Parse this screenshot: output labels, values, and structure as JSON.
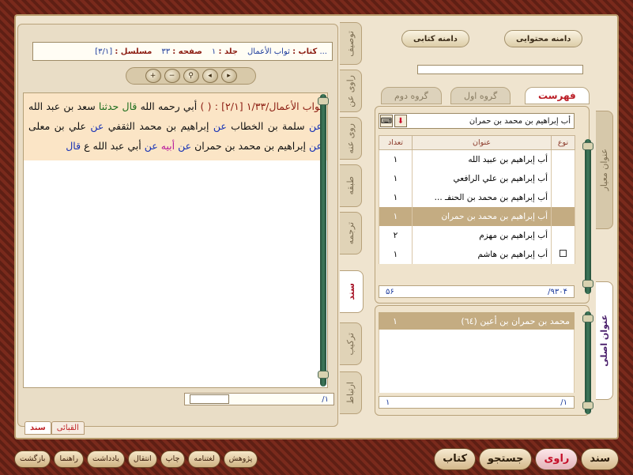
{
  "meta": {
    "book_label": "کتاب :",
    "book_value": "ثواب الأعمال",
    "ellipsis": "...",
    "volume_label": "جلد :",
    "volume_value": "۱",
    "page_label": "صفحه :",
    "page_value": "۳۳",
    "serial_label": "مسلسل :",
    "serial_value": "[۳/۱]"
  },
  "toolbar_icons": [
    "zoom-in",
    "zoom-out",
    "search",
    "prev",
    "next"
  ],
  "hadith": {
    "ref": "ثواب الأعمال/۱/۳۳ [۲/۱] : ( )",
    "p1": "أبي رحمه الله",
    "p2": "قال حدثنا",
    "p3": "سعد بن عبد الله",
    "p4": "عن",
    "p5": "سلمة بن الخطاب",
    "p6": "عن",
    "p7": "إبراهيم بن محمد الثقفي",
    "p8": "عن",
    "p9": "علي بن معلى",
    "p10": "عن",
    "p11": "إبراهيم بن محمد بن حمران",
    "p12": "عن",
    "p13": "أبيه",
    "p14": "عن",
    "p15": "أبي عبد الله ع",
    "p16": "قال"
  },
  "left_footer": {
    "page": "/۱"
  },
  "left_tags": {
    "active": "سند",
    "other": "القبائی"
  },
  "vertical_tabs": [
    "توصیف",
    "راوی عن",
    "روی عنه",
    "طبقه",
    "ترجمه",
    "سند",
    "ترکیب",
    "ارتباط"
  ],
  "vertical_tab_active": "سند",
  "top_pills": {
    "doc_scope": "دامنه کتابی",
    "content_scope": "دامنه محتوایی"
  },
  "group_tabs": {
    "index": "فهرست",
    "group1": "گروه اول",
    "group2": "گروه دوم"
  },
  "list": {
    "selected_value": "أب إبراهيم بن محمد بن حمران",
    "headers": {
      "count": "تعداد",
      "title": "عنوان",
      "type": "نوع"
    },
    "rows": [
      {
        "title": "أب إبراهيم بن عبيد الله",
        "count": "۱",
        "check": false,
        "selected": false
      },
      {
        "title": "أب إبراهيم بن علي الرافعي",
        "count": "۱",
        "check": false,
        "selected": false
      },
      {
        "title": "أب إبراهيم بن محمد بن الحنفـ ...",
        "count": "۱",
        "check": false,
        "selected": false
      },
      {
        "title": "أب إبراهيم بن محمد بن حمران",
        "count": "۱",
        "check": false,
        "selected": true
      },
      {
        "title": "أب إبراهيم بن مهزم",
        "count": "۲",
        "check": false,
        "selected": false
      },
      {
        "title": "أب إبراهيم بن هاشم",
        "count": "۱",
        "check": true,
        "selected": false
      }
    ],
    "footer_total": "/۹۳۰۴",
    "footer_value": "۵۶"
  },
  "result": {
    "title": "محمد بن حمران بن أعين (٦٤)",
    "count": "۱",
    "footer_page": "/۱",
    "footer_value": "۱"
  },
  "right_vtabs": {
    "standard": "عنوان معيار",
    "original": "عنوان اصلی"
  },
  "bottom_left": [
    "بازگشت",
    "راهنما",
    "یادداشت",
    "انتقال",
    "چاپ",
    "لغتنامه",
    "پژوهش"
  ],
  "bottom_right": [
    "سند",
    "راوی",
    "جستجو",
    "کتاب"
  ],
  "bottom_right_active": "راوی",
  "colors": {
    "accent_red": "#c5102a",
    "selection": "#c4ac82",
    "hadith_bg": "#fbe5c6",
    "frame": "#6b2418"
  }
}
